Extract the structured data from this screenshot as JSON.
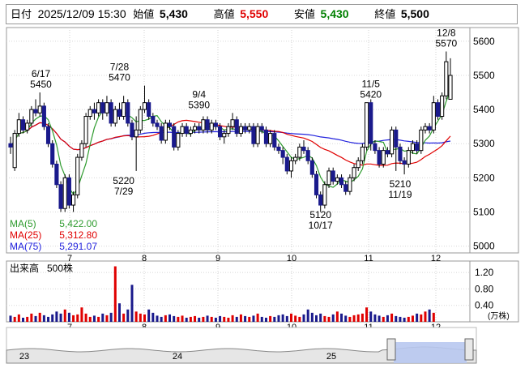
{
  "header": {
    "date_label": "日付",
    "date": "2025/12/09 15:30",
    "open_label": "始値",
    "open": "5,430",
    "high_label": "高値",
    "high": "5,550",
    "low_label": "安値",
    "low": "5,430",
    "close_label": "終値",
    "close": "5,500"
  },
  "chart_data": [
    {
      "type": "candlestick",
      "ylim": [
        4980,
        5640
      ],
      "yticks": [
        5000,
        5100,
        5200,
        5300,
        5400,
        5500,
        5600
      ],
      "x_months": [
        "7",
        "8",
        "9",
        "10",
        "11",
        "12"
      ],
      "legend": [
        {
          "name": "MA(5)",
          "value": "5,422.00",
          "color": "#2e9b2e"
        },
        {
          "name": "MA(25)",
          "value": "5,312.80",
          "color": "#e00000"
        },
        {
          "name": "MA(75)",
          "value": "5,291.07",
          "color": "#2222dd"
        }
      ],
      "annotations": [
        {
          "date": "6/17",
          "value": "5450"
        },
        {
          "date": "7/28",
          "value": "5470"
        },
        {
          "date": "7/29",
          "value": "5220"
        },
        {
          "date": "9/4",
          "value": "5390"
        },
        {
          "date": "10/17",
          "value": "5120"
        },
        {
          "date": "11/5",
          "value": "5420"
        },
        {
          "date": "11/19",
          "value": "5210"
        },
        {
          "date": "12/8",
          "value": "5570"
        }
      ],
      "candles": [
        [
          5300,
          5290,
          5320,
          5270
        ],
        [
          5230,
          5330,
          5340,
          5220
        ],
        [
          5330,
          5370,
          5390,
          5320
        ],
        [
          5370,
          5340,
          5380,
          5330
        ],
        [
          5340,
          5360,
          5370,
          5330
        ],
        [
          5360,
          5400,
          5410,
          5350
        ],
        [
          5400,
          5390,
          5430,
          5380
        ],
        [
          5390,
          5410,
          5450,
          5380
        ],
        [
          5410,
          5350,
          5420,
          5340
        ],
        [
          5350,
          5300,
          5360,
          5290
        ],
        [
          5300,
          5240,
          5310,
          5230
        ],
        [
          5240,
          5180,
          5250,
          5170
        ],
        [
          5180,
          5110,
          5190,
          5100
        ],
        [
          5110,
          5200,
          5210,
          5100
        ],
        [
          5200,
          5120,
          5210,
          5110
        ],
        [
          5120,
          5150,
          5160,
          5100
        ],
        [
          5150,
          5260,
          5270,
          5140
        ],
        [
          5260,
          5300,
          5310,
          5250
        ],
        [
          5300,
          5380,
          5390,
          5290
        ],
        [
          5380,
          5400,
          5410,
          5370
        ],
        [
          5400,
          5390,
          5420,
          5370
        ],
        [
          5390,
          5420,
          5430,
          5380
        ],
        [
          5420,
          5390,
          5430,
          5370
        ],
        [
          5390,
          5420,
          5440,
          5380
        ],
        [
          5420,
          5360,
          5430,
          5350
        ],
        [
          5360,
          5400,
          5410,
          5350
        ],
        [
          5400,
          5380,
          5420,
          5370
        ],
        [
          5380,
          5420,
          5440,
          5370
        ],
        [
          5420,
          5360,
          5430,
          5350
        ],
        [
          5360,
          5320,
          5370,
          5310
        ],
        [
          5320,
          5340,
          5380,
          5220
        ],
        [
          5340,
          5400,
          5410,
          5330
        ],
        [
          5400,
          5420,
          5470,
          5390
        ],
        [
          5420,
          5380,
          5430,
          5370
        ],
        [
          5380,
          5360,
          5390,
          5350
        ],
        [
          5360,
          5350,
          5370,
          5340
        ],
        [
          5350,
          5310,
          5360,
          5300
        ],
        [
          5310,
          5360,
          5370,
          5300
        ],
        [
          5360,
          5350,
          5370,
          5340
        ],
        [
          5350,
          5290,
          5360,
          5280
        ],
        [
          5290,
          5330,
          5340,
          5280
        ],
        [
          5330,
          5350,
          5360,
          5320
        ],
        [
          5350,
          5330,
          5360,
          5320
        ],
        [
          5330,
          5340,
          5350,
          5320
        ],
        [
          5340,
          5350,
          5360,
          5330
        ],
        [
          5350,
          5340,
          5360,
          5330
        ],
        [
          5340,
          5370,
          5380,
          5330
        ],
        [
          5370,
          5340,
          5380,
          5330
        ],
        [
          5340,
          5360,
          5370,
          5330
        ],
        [
          5360,
          5350,
          5370,
          5340
        ],
        [
          5350,
          5320,
          5360,
          5310
        ],
        [
          5320,
          5330,
          5340,
          5300
        ],
        [
          5330,
          5350,
          5360,
          5320
        ],
        [
          5350,
          5370,
          5390,
          5340
        ],
        [
          5370,
          5330,
          5380,
          5320
        ],
        [
          5330,
          5350,
          5360,
          5320
        ],
        [
          5350,
          5340,
          5360,
          5330
        ],
        [
          5340,
          5350,
          5360,
          5330
        ],
        [
          5350,
          5300,
          5360,
          5290
        ],
        [
          5300,
          5350,
          5360,
          5290
        ],
        [
          5350,
          5340,
          5360,
          5330
        ],
        [
          5340,
          5300,
          5350,
          5290
        ],
        [
          5300,
          5330,
          5340,
          5290
        ],
        [
          5330,
          5290,
          5340,
          5280
        ],
        [
          5290,
          5280,
          5300,
          5270
        ],
        [
          5280,
          5260,
          5290,
          5240
        ],
        [
          5260,
          5220,
          5270,
          5210
        ],
        [
          5220,
          5250,
          5260,
          5200
        ],
        [
          5250,
          5260,
          5270,
          5240
        ],
        [
          5260,
          5290,
          5300,
          5250
        ],
        [
          5290,
          5280,
          5310,
          5270
        ],
        [
          5280,
          5250,
          5290,
          5240
        ],
        [
          5250,
          5210,
          5260,
          5200
        ],
        [
          5210,
          5150,
          5220,
          5140
        ],
        [
          5150,
          5120,
          5160,
          5100
        ],
        [
          5120,
          5180,
          5190,
          5110
        ],
        [
          5180,
          5220,
          5230,
          5170
        ],
        [
          5220,
          5190,
          5230,
          5180
        ],
        [
          5190,
          5200,
          5210,
          5180
        ],
        [
          5200,
          5180,
          5210,
          5170
        ],
        [
          5180,
          5160,
          5190,
          5150
        ],
        [
          5160,
          5200,
          5210,
          5150
        ],
        [
          5200,
          5230,
          5240,
          5190
        ],
        [
          5230,
          5250,
          5260,
          5220
        ],
        [
          5250,
          5290,
          5300,
          5240
        ],
        [
          5290,
          5420,
          5420,
          5280
        ],
        [
          5420,
          5300,
          5430,
          5280
        ],
        [
          5300,
          5280,
          5310,
          5270
        ],
        [
          5280,
          5240,
          5290,
          5230
        ],
        [
          5240,
          5280,
          5290,
          5230
        ],
        [
          5280,
          5270,
          5290,
          5260
        ],
        [
          5270,
          5340,
          5350,
          5260
        ],
        [
          5340,
          5290,
          5350,
          5220
        ],
        [
          5290,
          5250,
          5300,
          5240
        ],
        [
          5250,
          5240,
          5260,
          5210
        ],
        [
          5240,
          5280,
          5290,
          5230
        ],
        [
          5280,
          5300,
          5310,
          5270
        ],
        [
          5300,
          5280,
          5310,
          5270
        ],
        [
          5280,
          5340,
          5350,
          5270
        ],
        [
          5340,
          5350,
          5360,
          5330
        ],
        [
          5350,
          5340,
          5360,
          5330
        ],
        [
          5340,
          5420,
          5440,
          5330
        ],
        [
          5420,
          5380,
          5430,
          5370
        ],
        [
          5380,
          5440,
          5450,
          5370
        ],
        [
          5440,
          5540,
          5570,
          5430
        ],
        [
          5430,
          5500,
          5550,
          5430
        ]
      ]
    },
    {
      "type": "bar",
      "title": "出来高",
      "unit_label": "500株",
      "unit_note": "(万株)",
      "ylim": [
        0,
        1.4
      ],
      "yticks": [
        "1.20",
        "0.80",
        "0.40"
      ],
      "volumes": [
        0.15,
        0.12,
        0.18,
        0.1,
        0.12,
        0.2,
        0.14,
        0.22,
        0.16,
        0.12,
        0.18,
        0.25,
        0.2,
        0.3,
        0.22,
        0.16,
        0.18,
        0.35,
        0.2,
        0.12,
        0.15,
        0.12,
        0.2,
        0.16,
        0.22,
        1.35,
        0.45,
        0.2,
        0.3,
        0.9,
        0.25,
        0.2,
        0.18,
        0.3,
        0.22,
        0.15,
        0.12,
        0.16,
        0.18,
        0.14,
        0.12,
        0.15,
        0.1,
        0.12,
        0.14,
        0.1,
        0.12,
        0.15,
        0.12,
        0.1,
        0.14,
        0.12,
        0.1,
        0.16,
        0.12,
        0.18,
        0.14,
        0.12,
        0.15,
        0.2,
        0.12,
        0.1,
        0.14,
        0.12,
        0.16,
        0.18,
        0.14,
        0.2,
        0.15,
        0.12,
        0.18,
        0.3,
        0.22,
        0.16,
        0.2,
        0.14,
        0.12,
        0.18,
        0.25,
        0.2,
        0.15,
        0.12,
        0.16,
        0.18,
        0.2,
        0.35,
        0.25,
        0.18,
        0.15,
        0.12,
        0.16,
        0.2,
        0.14,
        0.12,
        0.1,
        0.12,
        0.15,
        0.2,
        0.18,
        0.25,
        0.3,
        0.22
      ]
    },
    {
      "type": "area",
      "title": "navigator",
      "x_labels": [
        "23",
        "24",
        "25"
      ]
    }
  ]
}
